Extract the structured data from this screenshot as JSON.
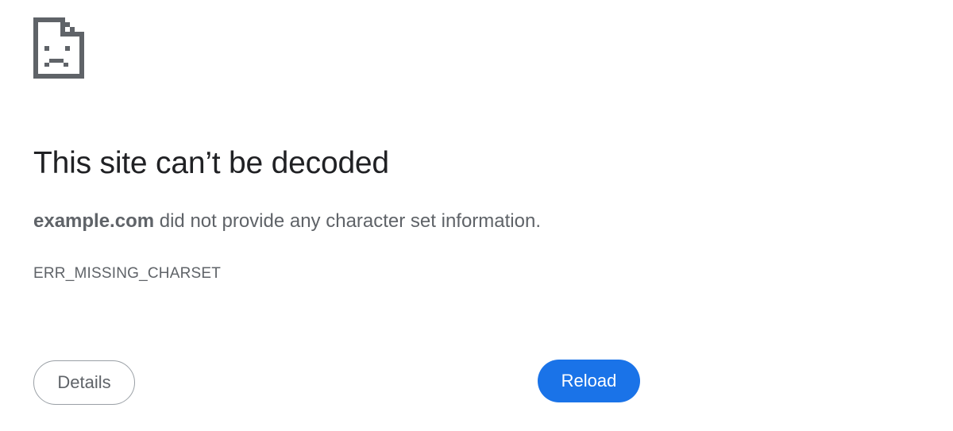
{
  "error_page": {
    "icon": "sad-file-icon",
    "title": "This site can’t be decoded",
    "summary_host": "example.com",
    "summary_text": " did not provide any character set information.",
    "error_code": "ERR_MISSING_CHARSET",
    "details_label": "Details",
    "reload_label": "Reload"
  },
  "colors": {
    "title": "#202124",
    "body_text": "#5f6368",
    "primary_button": "#1a73e8",
    "icon": "#5f6368"
  }
}
